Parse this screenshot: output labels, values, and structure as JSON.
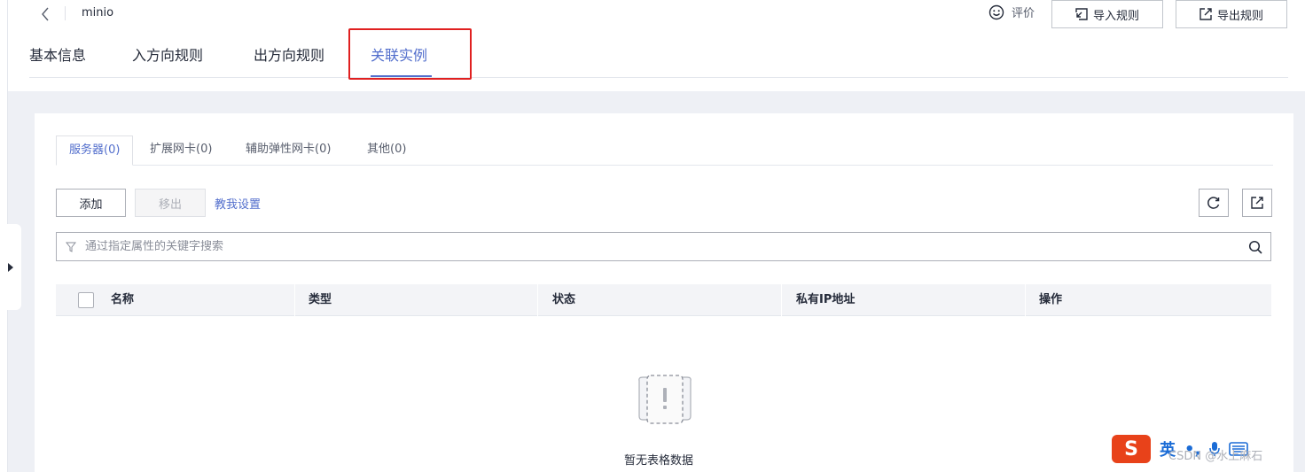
{
  "header": {
    "title": "minio",
    "rate_label": "评价",
    "import_label": "导入规则",
    "export_label": "导出规则"
  },
  "tabs": [
    {
      "label": "基本信息"
    },
    {
      "label": "入方向规则"
    },
    {
      "label": "出方向规则"
    },
    {
      "label": "关联实例",
      "active": true
    }
  ],
  "subtabs": [
    {
      "label": "服务器(0)",
      "active": true
    },
    {
      "label": "扩展网卡(0)"
    },
    {
      "label": "辅助弹性网卡(0)"
    },
    {
      "label": "其他(0)"
    }
  ],
  "toolbar": {
    "add_label": "添加",
    "remove_label": "移出",
    "help_label": "教我设置"
  },
  "search": {
    "placeholder": "通过指定属性的关键字搜索"
  },
  "table": {
    "columns": [
      "名称",
      "类型",
      "状态",
      "私有IP地址",
      "操作"
    ],
    "empty_text": "暂无表格数据"
  },
  "ime": {
    "logo": "S",
    "lang": "英"
  },
  "watermark": "CSDN @水上麻石",
  "colors": {
    "accent": "#526ecc",
    "highlight_border": "#e02020",
    "background": "#eef0f5"
  }
}
